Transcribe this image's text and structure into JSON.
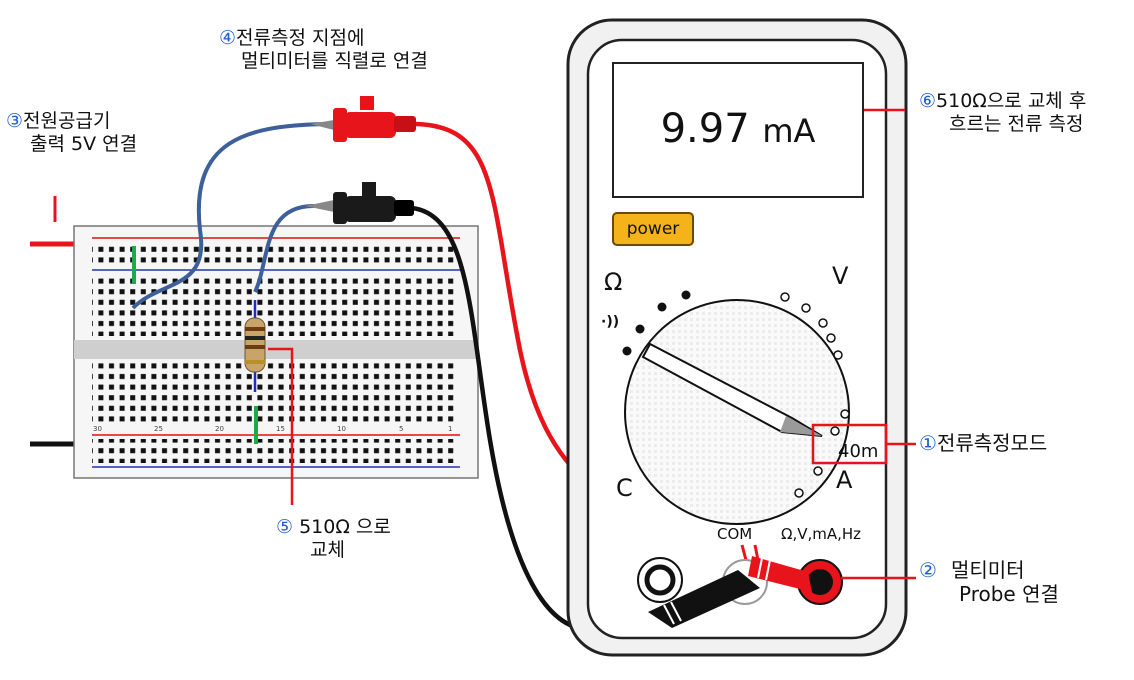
{
  "display": {
    "value": "9.97",
    "unit": "mA"
  },
  "power_label": "power",
  "dial": {
    "ohm": "Ω",
    "volt": "V",
    "amp": "A",
    "cap": "C",
    "selected_range": "40m",
    "buzzer": "·))"
  },
  "jacks": {
    "com": "COM",
    "input": "Ω,V,mA,Hz"
  },
  "breadboard": {
    "col_numbers": [
      "30",
      "25",
      "20",
      "15",
      "10",
      "5",
      "1"
    ]
  },
  "annotations": [
    {
      "num": "①",
      "text": "전류측정모드"
    },
    {
      "num": "②",
      "line1": "멀티미터",
      "line2": "Probe 연결"
    },
    {
      "num": "③",
      "line1": "전원공급기",
      "line2": "출력 5V 연결"
    },
    {
      "num": "④",
      "line1": "전류측정 지점에",
      "line2": "멀티미터를 직렬로 연결"
    },
    {
      "num": "⑤",
      "line1": "510Ω 으로",
      "line2": "교체"
    },
    {
      "num": "⑥",
      "line1": "510Ω으로 교체 후",
      "line2": "흐르는 전류 측정"
    }
  ],
  "colors": {
    "red": "#e8141c",
    "black": "#111111",
    "blue_wire": "#3d5f9a",
    "knob_yellow": "#f6b21a",
    "label_blue": "#1f5fd6"
  }
}
